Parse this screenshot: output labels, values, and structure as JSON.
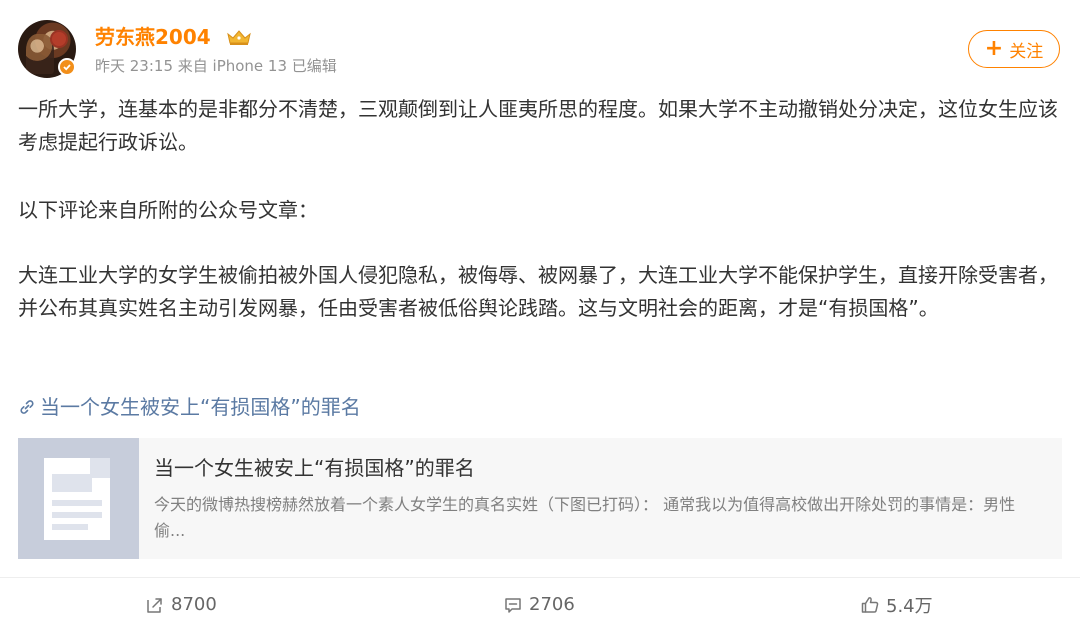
{
  "post": {
    "author": {
      "name": "劳东燕2004",
      "badge_icon": "crown-icon",
      "verified_icon": "verified-badge-icon",
      "accent": "#ff8200"
    },
    "meta": "昨天 23:15  来自 iPhone 13 已编辑",
    "follow_label": "关注",
    "paragraphs": [
      "一所大学，连基本的是非都分不清楚，三观颠倒到让人匪夷所思的程度。如果大学不主动撤销处分决定，这位女生应该考虑提起行政诉讼。",
      "以下评论来自所附的公众号文章：",
      "大连工业大学的女学生被偷拍被外国人侵犯隐私，被侮辱、被网暴了，大连工业大学不能保护学生，直接开除受害者，并公布其真实姓名主动引发网暴，任由受害者被低俗舆论践踏。这与文明社会的距离，才是“有损国格”。"
    ],
    "link_text": "当一个女生被安上“有损国格”的罪名",
    "card": {
      "title": "当一个女生被安上“有损国格”的罪名",
      "description": "今天的微博热搜榜赫然放着一个素人女学生的真名实姓（下图已打码）： 通常我以为值得高校做出开除处罚的事情是：男性偷..."
    },
    "actions": {
      "repost_count": "8700",
      "comment_count": "2706",
      "like_count": "5.4万"
    }
  }
}
